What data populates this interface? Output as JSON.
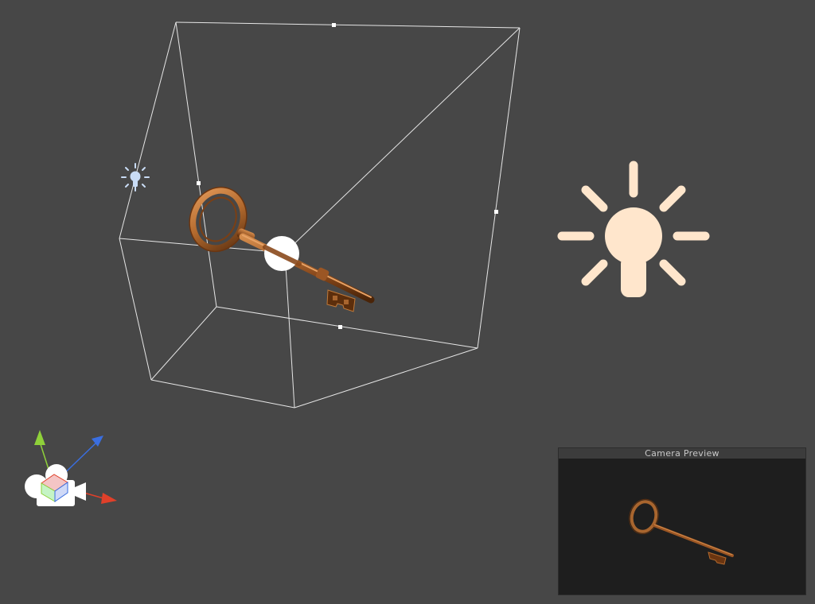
{
  "camera_preview": {
    "title": "Camera Preview"
  },
  "icons": {
    "directional_light": "small-sun-light-icon",
    "point_light": "lightbulb-icon",
    "camera": "camera-icon",
    "scene_gizmo": "axis-gizmo-icon"
  },
  "colors": {
    "background": "#474747",
    "frustum_lines": "#e6e6e6",
    "light_gizmo": "#ffe6cc",
    "key_copper": "#b36a2e",
    "axis_x": "#e0402a",
    "axis_y": "#8fd13a",
    "axis_z": "#3a6ee0"
  }
}
